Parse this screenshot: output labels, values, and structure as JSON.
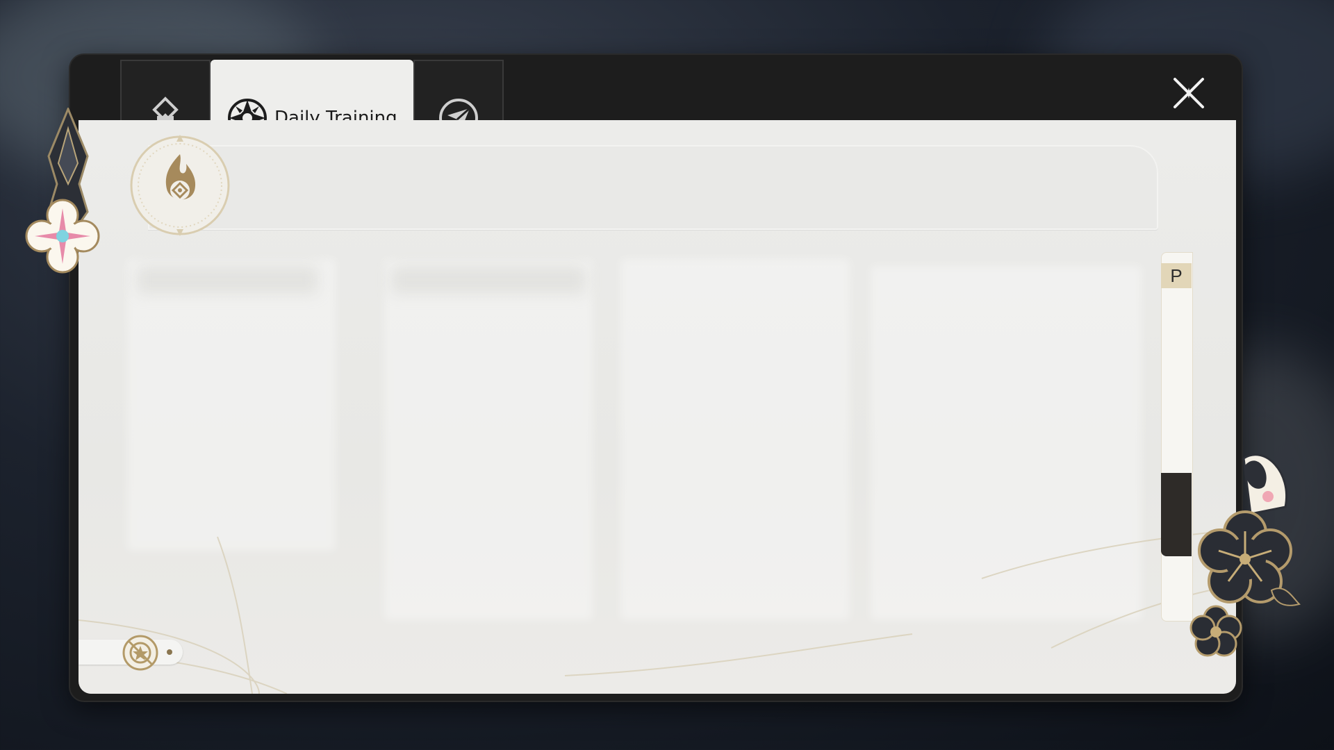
{
  "window": {
    "tabs": [
      {
        "icon": "diamond-emblem-icon",
        "label": ""
      },
      {
        "icon": "compass-wheel-icon",
        "label": "Daily Training"
      },
      {
        "icon": "paper-plane-icon",
        "label": ""
      }
    ],
    "close_icon": "close-icon"
  },
  "header": {
    "emblem_icon": "flame-emblem-icon"
  },
  "side_panel": {
    "tag_label": "P"
  },
  "colors": {
    "accent_gold": "#a48a5e",
    "dark": "#1d1d1d",
    "panel_bg": "#ecece9"
  }
}
